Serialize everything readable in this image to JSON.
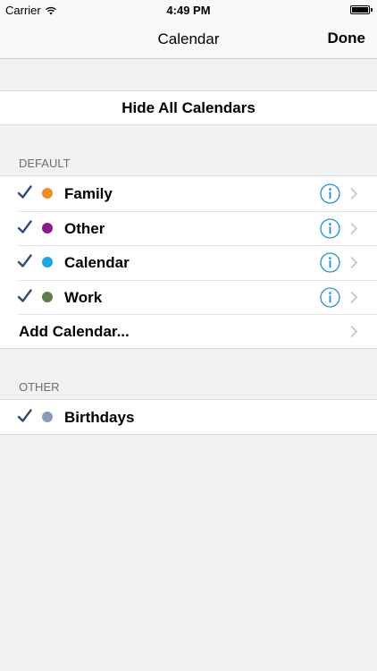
{
  "status_bar": {
    "carrier": "Carrier",
    "time": "4:49 PM",
    "battery_level": 1.0
  },
  "nav": {
    "title": "Calendar",
    "done_label": "Done"
  },
  "hide_all_label": "Hide All Calendars",
  "sections": {
    "default": {
      "header": "DEFAULT",
      "items": [
        {
          "label": "Family",
          "color": "#f28c1e",
          "checked": true
        },
        {
          "label": "Other",
          "color": "#8b1a8c",
          "checked": true
        },
        {
          "label": "Calendar",
          "color": "#1aa7e8",
          "checked": true
        },
        {
          "label": "Work",
          "color": "#5f7f49",
          "checked": true
        }
      ],
      "add_label": "Add Calendar..."
    },
    "other": {
      "header": "OTHER",
      "items": [
        {
          "label": "Birthdays",
          "color": "#8a9bb5",
          "checked": true
        }
      ]
    }
  },
  "colors": {
    "accent": "#1a8fd6",
    "check": "#2f4b73",
    "chevron": "#c7c7cc"
  },
  "icons": {
    "check": "checkmark-icon",
    "info": "info-circle-icon",
    "chevron": "chevron-right-icon",
    "wifi": "wifi-icon",
    "battery": "battery-icon"
  }
}
